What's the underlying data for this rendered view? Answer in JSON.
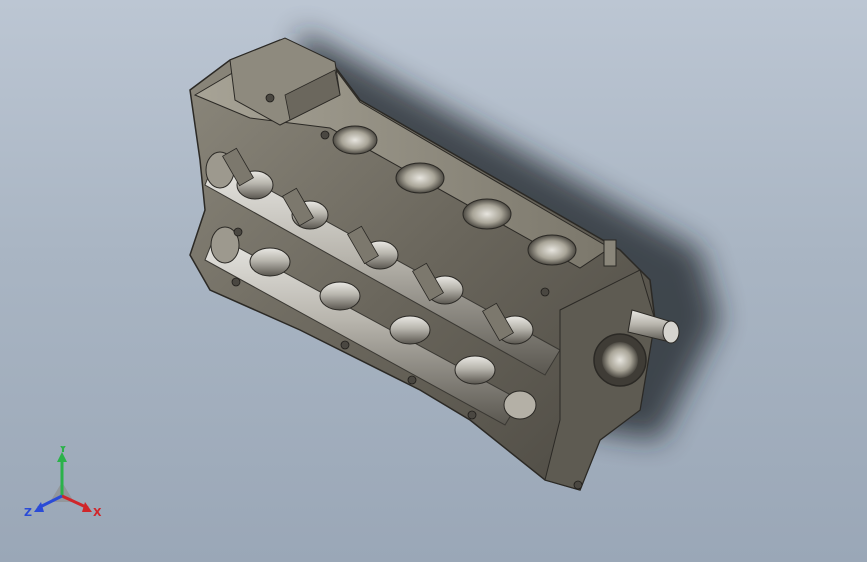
{
  "viewport": {
    "background_top": "#bcc6d3",
    "background_bottom": "#9aa7b7",
    "model_name_icon": "engine-cylinder-head-icon",
    "model_color": "#6e6a60"
  },
  "triad": {
    "x_label": "X",
    "y_label": "Y",
    "z_label": "Z",
    "x_color": "#d0262a",
    "y_color": "#2bb24a",
    "z_color": "#2a4bd7"
  }
}
